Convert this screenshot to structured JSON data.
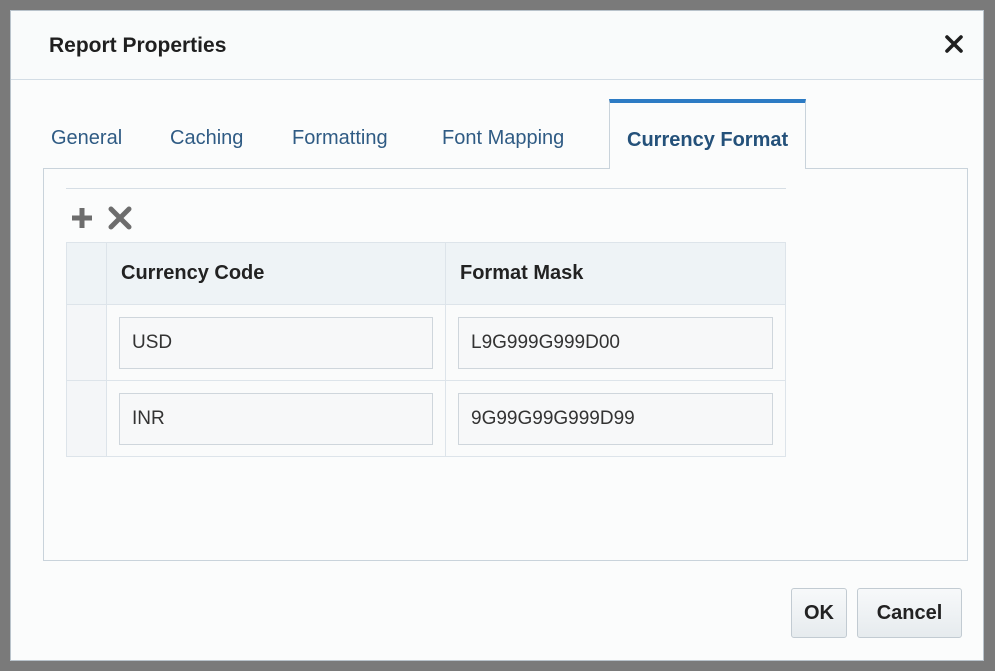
{
  "dialog": {
    "title": "Report Properties",
    "close_icon": "close-icon"
  },
  "tabs": [
    {
      "label": "General",
      "active": false
    },
    {
      "label": "Caching",
      "active": false
    },
    {
      "label": "Formatting",
      "active": false
    },
    {
      "label": "Font Mapping",
      "active": false
    },
    {
      "label": "Currency Format",
      "active": true
    }
  ],
  "toolbar": {
    "add_icon": "plus-icon",
    "delete_icon": "x-delete-icon"
  },
  "table": {
    "columns": [
      "Currency Code",
      "Format Mask"
    ],
    "rows": [
      {
        "currency_code": "USD",
        "format_mask": "L9G999G999D00"
      },
      {
        "currency_code": "INR",
        "format_mask": "9G99G99G999D99"
      }
    ]
  },
  "footer": {
    "ok_label": "OK",
    "cancel_label": "Cancel"
  },
  "colors": {
    "active_tab_accent": "#2c7bc4",
    "tab_text": "#2f5b84",
    "icon_gray": "#6d6d6d"
  }
}
